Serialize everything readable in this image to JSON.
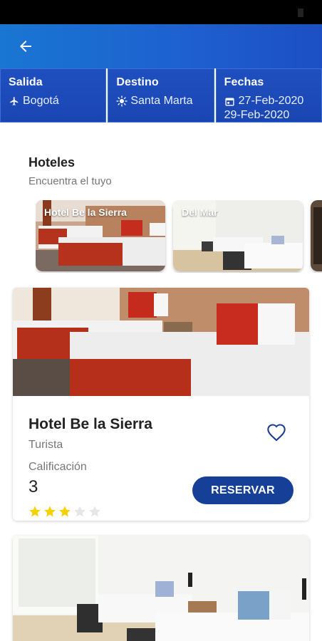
{
  "app_bar": {
    "back_icon": "arrow-left-icon"
  },
  "trip": {
    "origin": {
      "label": "Salida",
      "value": "Bogotá",
      "icon": "airplane-icon"
    },
    "destination": {
      "label": "Destino",
      "value": "Santa Marta",
      "icon": "sun-icon"
    },
    "dates": {
      "label": "Fechas",
      "start": "27-Feb-2020",
      "end": "29-Feb-2020",
      "icon": "calendar-icon"
    }
  },
  "hotels_section": {
    "title": "Hoteles",
    "subtitle": "Encuentra el tuyo",
    "carousel": [
      {
        "name": "Hotel Be la Sierra"
      },
      {
        "name": "Del Mar"
      },
      {
        "name": ""
      }
    ]
  },
  "hotel_card": {
    "name": "Hotel Be la Sierra",
    "category": "Turista",
    "rating_label": "Calificación",
    "rating_value": "3",
    "stars_filled": 3,
    "stars_total": 5,
    "reserve_label": "RESERVAR",
    "favorite_icon": "heart-outline-icon"
  },
  "colors": {
    "primary": "#1f4fbf",
    "button": "#163f97",
    "star_filled": "#f6d100",
    "star_empty": "#e6e6e6"
  }
}
